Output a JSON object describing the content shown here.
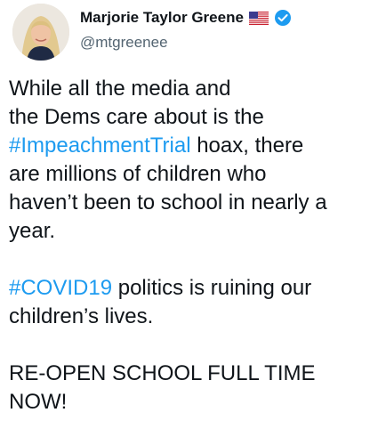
{
  "author": {
    "display_name": "Marjorie Taylor Greene",
    "handle": "@mtgreenee",
    "badge_icon": "verified-icon",
    "flag_icon": "us-flag-icon",
    "accent_color": "#1d9bf0"
  },
  "tweet": {
    "p1_a": "While all the media and",
    "p1_b": "the Dems care about is the",
    "p1_hashtag": "#ImpeachmentTrial",
    "p1_c": " hoax, there",
    "p1_d": "are millions of children who",
    "p1_e": "haven’t been to school in nearly a",
    "p1_f": "year.",
    "p2_hashtag": "#COVID19",
    "p2_a": " politics is ruining our",
    "p2_b": "children’s lives.",
    "p3_a": "RE-OPEN SCHOOL FULL TIME",
    "p3_b": "NOW!"
  }
}
